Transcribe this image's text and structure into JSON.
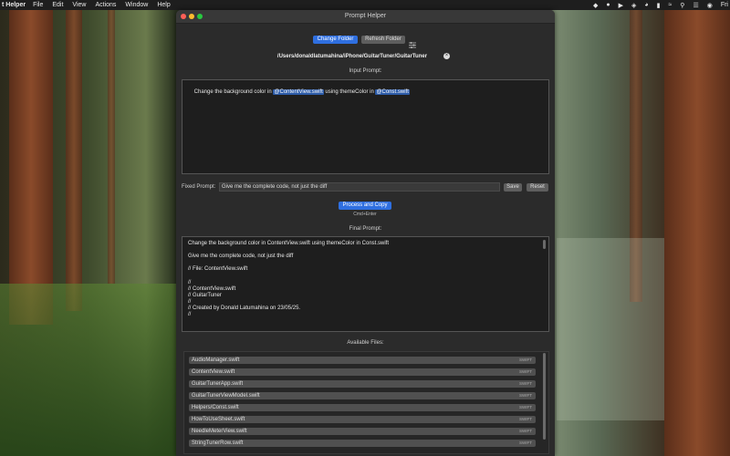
{
  "menubar": {
    "app_name": "t Helper",
    "items": [
      "File",
      "Edit",
      "View",
      "Actions",
      "Window",
      "Help"
    ],
    "clock": "Fri"
  },
  "window": {
    "title": "Prompt Helper",
    "change_folder_label": "Change Folder",
    "refresh_folder_label": "Refresh Folder",
    "folder_path": "/Users/donaldlatumahina/iPhone/GuitarTuner/GuitarTuner",
    "input_prompt_label": "Input Prompt:",
    "input_prompt": {
      "part1": "Change the background color in ",
      "ref1": "@ContentView.swift",
      "part2": " using themeColor in ",
      "ref2": "@Const.swift"
    },
    "fixed_prompt_label": "Fixed Prompt:",
    "fixed_prompt_value": "Give me the complete code, not just the diff",
    "save_label": "Save",
    "reset_label": "Reset",
    "process_label": "Process and Copy",
    "process_shortcut": "Cmd+Enter",
    "final_prompt_label": "Final Prompt:",
    "final_prompt_lines": [
      "Change the background color in ContentView.swift using themeColor in Const.swift",
      "",
      "Give me the complete code, not just the diff",
      "",
      "// File: ContentView.swift",
      "",
      "//",
      "//  ContentView.swift",
      "//  GuitarTuner",
      "//",
      "//  Created by Donald Latumahina on 23/05/25.",
      "//"
    ],
    "available_files_label": "Available Files:",
    "files": [
      {
        "name": "AudioManager.swift",
        "type": "SWIFT"
      },
      {
        "name": "ContentView.swift",
        "type": "SWIFT"
      },
      {
        "name": "GuitarTunerApp.swift",
        "type": "SWIFT"
      },
      {
        "name": "GuitarTunerViewModel.swift",
        "type": "SWIFT"
      },
      {
        "name": "Helpers/Const.swift",
        "type": "SWIFT"
      },
      {
        "name": "HowToUseSheet.swift",
        "type": "SWIFT"
      },
      {
        "name": "NeedleMeterView.swift",
        "type": "SWIFT"
      },
      {
        "name": "StringTunerRow.swift",
        "type": "SWIFT"
      }
    ]
  },
  "colors": {
    "accent": "#2f6fe0",
    "window_bg": "#2b2b2b",
    "text_area_bg": "#1e1e1e",
    "close": "#ff5f57",
    "minimize": "#febc2e",
    "zoom": "#28c840"
  }
}
